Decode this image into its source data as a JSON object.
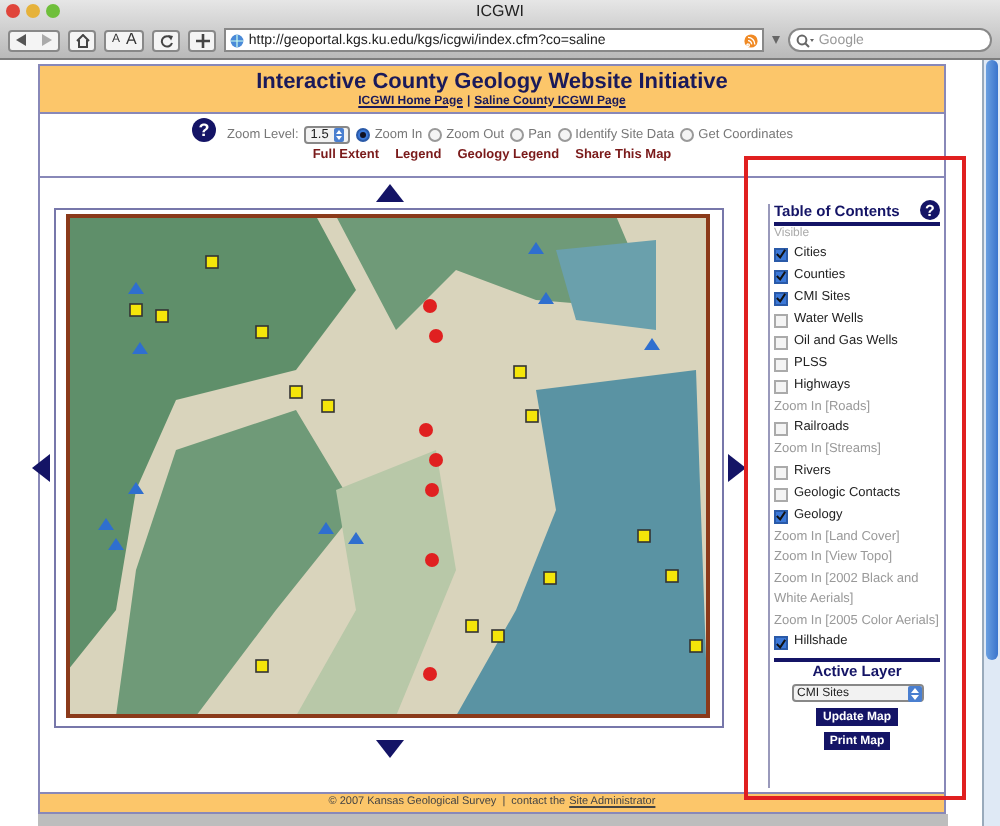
{
  "window": {
    "title": "ICGWI"
  },
  "toolbar": {
    "url": "http://geoportal.kgs.ku.edu/kgs/icgwi/index.cfm?co=saline",
    "search": {
      "placeholder": "Google"
    },
    "text_size_buttons": [
      "A",
      "A"
    ]
  },
  "header": {
    "title": "Interactive County Geology Website Initiative",
    "links": [
      "ICGWI Home Page",
      "Saline County ICGWI Page"
    ],
    "separator": "|"
  },
  "map_tools": {
    "help": "?",
    "zoom_label": "Zoom Level:",
    "zoom_value": "1.5",
    "modes": [
      {
        "label": "Zoom In",
        "selected": true
      },
      {
        "label": "Zoom Out",
        "selected": false
      },
      {
        "label": "Pan",
        "selected": false
      },
      {
        "label": "Identify Site Data",
        "selected": false
      },
      {
        "label": "Get Coordinates",
        "selected": false
      }
    ],
    "links": [
      "Full Extent",
      "Legend",
      "Geology Legend",
      "Share This Map"
    ]
  },
  "toc": {
    "title": "Table of Contents",
    "help": "?",
    "visible_label": "Visible",
    "items": [
      {
        "kind": "checkbox",
        "label": "Cities",
        "checked": true
      },
      {
        "kind": "checkbox",
        "label": "Counties",
        "checked": true
      },
      {
        "kind": "checkbox",
        "label": "CMI Sites",
        "checked": true
      },
      {
        "kind": "checkbox",
        "label": "Water Wells",
        "checked": false
      },
      {
        "kind": "checkbox",
        "label": "Oil and Gas Wells",
        "checked": false
      },
      {
        "kind": "checkbox",
        "label": "PLSS",
        "checked": false
      },
      {
        "kind": "checkbox",
        "label": "Highways",
        "checked": false
      },
      {
        "kind": "note",
        "label": "Zoom In [Roads]"
      },
      {
        "kind": "checkbox",
        "label": "Railroads",
        "checked": false
      },
      {
        "kind": "note",
        "label": "Zoom In [Streams]"
      },
      {
        "kind": "checkbox",
        "label": "Rivers",
        "checked": false
      },
      {
        "kind": "checkbox",
        "label": "Geologic Contacts",
        "checked": false
      },
      {
        "kind": "checkbox",
        "label": "Geology",
        "checked": true
      },
      {
        "kind": "note",
        "label": "Zoom In [Land Cover]"
      },
      {
        "kind": "note",
        "label": "Zoom In [View Topo]"
      },
      {
        "kind": "note",
        "label": "Zoom In [2002 Black and White Aerials]"
      },
      {
        "kind": "note",
        "label": "Zoom In [2005 Color Aerials]"
      },
      {
        "kind": "checkbox",
        "label": "Hillshade",
        "checked": true
      }
    ],
    "active_layer_label": "Active Layer",
    "active_layer_value": "CMI Sites",
    "buttons": [
      "Update Map",
      "Print Map"
    ]
  },
  "footer": {
    "text": "© 2007 Kansas Geological Survey  |  contact the",
    "link": "Site Administrator"
  }
}
